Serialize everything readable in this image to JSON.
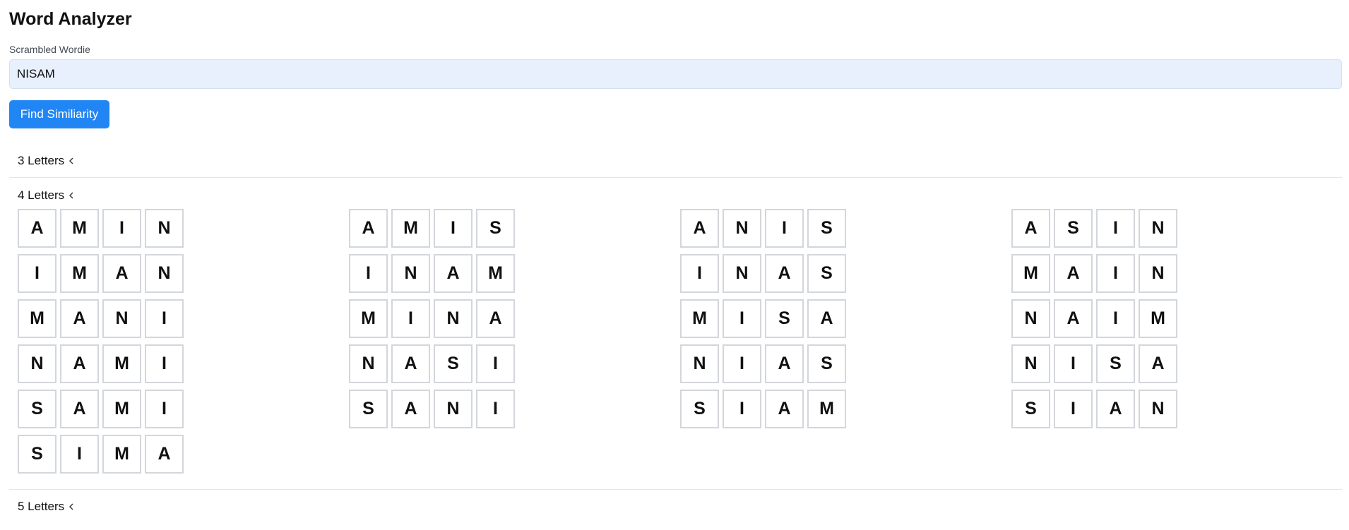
{
  "app": {
    "title": "Word Analyzer"
  },
  "form": {
    "label": "Scrambled Wordie",
    "value": "NISAM",
    "button_label": "Find Similiarity"
  },
  "groups": [
    {
      "label": "3 Letters",
      "expanded": false
    },
    {
      "label": "4 Letters",
      "expanded": true
    },
    {
      "label": "5 Letters",
      "expanded": false
    }
  ],
  "four_letter_words": {
    "columns": [
      [
        "AMIN",
        "IMAN",
        "MANI",
        "NAMI",
        "SAMI",
        "SIMA"
      ],
      [
        "AMIS",
        "INAM",
        "MINA",
        "NASI",
        "SANI"
      ],
      [
        "ANIS",
        "INAS",
        "MISA",
        "NIAS",
        "SIAM"
      ],
      [
        "ASIN",
        "MAIN",
        "NAIM",
        "NISA",
        "SIAN"
      ]
    ]
  },
  "colors": {
    "accent": "#2186f3",
    "input_background": "#e8f0fe",
    "tile_border": "#d3d6da",
    "divider": "#e2e5e9"
  }
}
